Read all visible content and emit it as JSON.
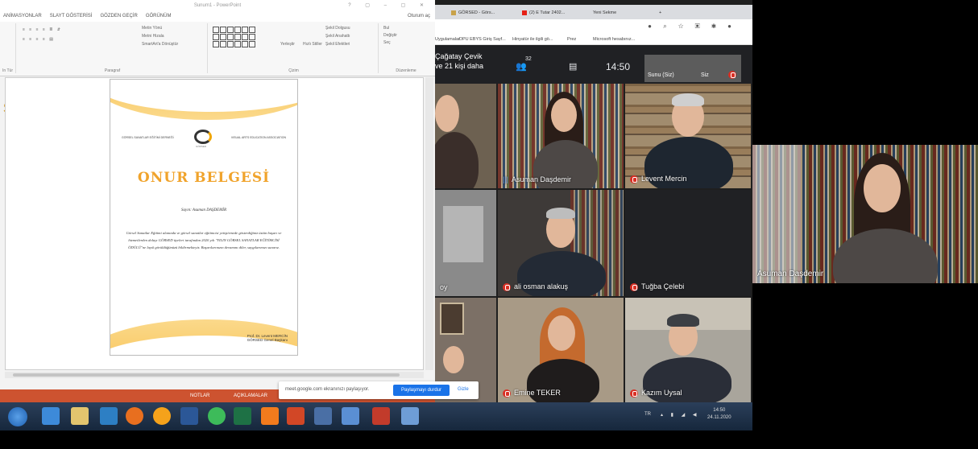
{
  "powerpoint": {
    "title": "Sunum1 - PowerPoint",
    "tabs": [
      "ANİMASYONLAR",
      "SLAYT GÖSTERİSİ",
      "GÖZDEN GEÇİR",
      "GÖRÜNÜM"
    ],
    "user": "Oturum aç",
    "ribbon": {
      "paragraph": "Paragraf",
      "drawing": "Çizim",
      "editing": "Düzenleme",
      "text_dir": "Metin Yönü",
      "align_text": "Metni Hizala",
      "smartart": "SmartArt'a Dönüştür",
      "arrange": "Yerleştir",
      "quick_styles": "Hızlı Stiller",
      "shape_fill": "Şekil Dolgusu",
      "shape_outline": "Şekil Anahattı",
      "shape_effects": "Şekil Efektleri",
      "find": "Bul",
      "replace": "Değiştir",
      "select": "Seç",
      "tab_stop": "In Tür"
    },
    "status_notes": "NOTLAR",
    "status_comments": "AÇIKLAMALAR",
    "side_char": "şi"
  },
  "certificate": {
    "org_left": "GÖRSEL SANATLAR EĞİTİMİ DERNEĞİ",
    "org_right": "VISUAL ARTS EDUCATION ASSOCIATION",
    "org_short": "GÖRSED",
    "title": "ONUR BELGESİ",
    "recipient": "Sayın: Asuman DAŞDEMİR",
    "body": "Görsel Sanatlar Eğitimi alanında ve görsel sanatlar eğitimcisi yetiştirmede gösterdiğiniz üstün başarı ve hizmetlerden dolayı GÖRSED üyeleri tarafından 2020 yılı \"YILIN GÖRSEL SANATLAR EĞİTİMCİSİ ÖDÜLÜ\"ne layık görüldüğünüzü bildirmekteyiz. Başarılarınızın devamını diler, saygılarımızı sunarız.",
    "signer": "Prof. Dr. Levent MERCİN",
    "signer_role": "GÖRSED Genel Başkanı"
  },
  "chrome": {
    "tab1": "GÖRSED - Görs...",
    "tab2": "(2) E Tutar 2402...",
    "tab3": "Yeni Sekme",
    "new_tab": "+",
    "bookmarks": [
      "Uygulamalar",
      "DPU EBYS Giriş Sayf...",
      "Hinyatür ile ilgili gö...",
      "Prez",
      "Microsoft hesabınız..."
    ]
  },
  "meet": {
    "presenter_line1": "Çağatay Çevik",
    "presenter_line2": "ve 21 kişi daha",
    "participant_count": "32",
    "clock": "14:50",
    "self_label": "Sunu (Siz)",
    "self_label2": "Siz",
    "participants": [
      {
        "name": "Asuman Daşdemir",
        "muted": false
      },
      {
        "name": "Levent Mercin",
        "muted": true
      },
      {
        "name": "ali osman alakuş",
        "muted": true
      },
      {
        "name": "Tuğba Çelebi",
        "muted": true
      },
      {
        "name": "Emine TEKER",
        "muted": true
      },
      {
        "name": "Kazım Uysal",
        "muted": true
      }
    ],
    "partial_left": "oy",
    "share_notice": "meet.google.com ekranınızı paylaşıyor.",
    "share_stop": "Paylaşmayı durdur",
    "share_hide": "Gizle"
  },
  "speaker": {
    "name": "Asuman Daşdemir"
  },
  "taskbar": {
    "tray_lang": "TR",
    "time": "14:50",
    "date": "24.11.2020"
  }
}
